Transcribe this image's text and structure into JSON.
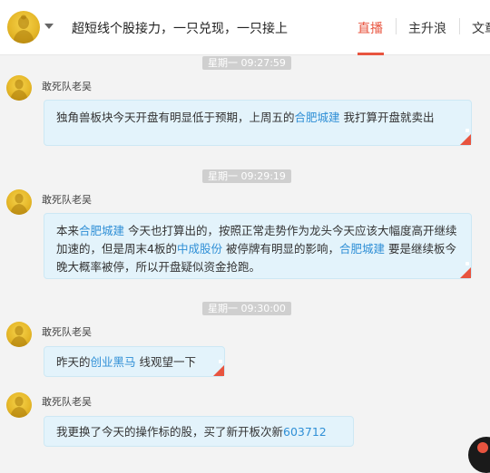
{
  "header": {
    "title": "超短线个股接力，一只兑现，一只接上",
    "tabs": [
      {
        "label": "直播",
        "active": true
      },
      {
        "label": "主升浪",
        "active": false
      },
      {
        "label": "文章",
        "active": false
      }
    ]
  },
  "colors": {
    "accent": "#e8543f",
    "stock_link": "#2f8fd6",
    "bubble_bg": "#e3f3fb"
  },
  "messages": [
    {
      "time": "星期一 09:27:59",
      "sender": "敢死队老吴",
      "parts": [
        "独角兽板块今天开盘有明显低于预期，上周五的",
        "合肥城建",
        " 我打算开盘就卖出"
      ]
    },
    {
      "time": "星期一 09:29:19",
      "sender": "敢死队老吴",
      "parts": [
        "本来",
        "合肥城建",
        " 今天也打算出的，按照正常走势作为龙头今天应该大幅度高开继续加速的，但是周末4板的",
        "中成股份",
        " 被停牌有明显的影响，",
        "合肥城建",
        " 要是继续板今晚大概率被停，所以开盘疑似资金抢跑。"
      ]
    },
    {
      "time": "星期一 09:30:00",
      "sender": "敢死队老吴",
      "parts": [
        "昨天的",
        "创业黑马",
        " 线观望一下"
      ]
    },
    {
      "time": "",
      "sender": "敢死队老吴",
      "parts": [
        "我更换了今天的操作标的股，买了新开板次新",
        "603712"
      ]
    }
  ]
}
